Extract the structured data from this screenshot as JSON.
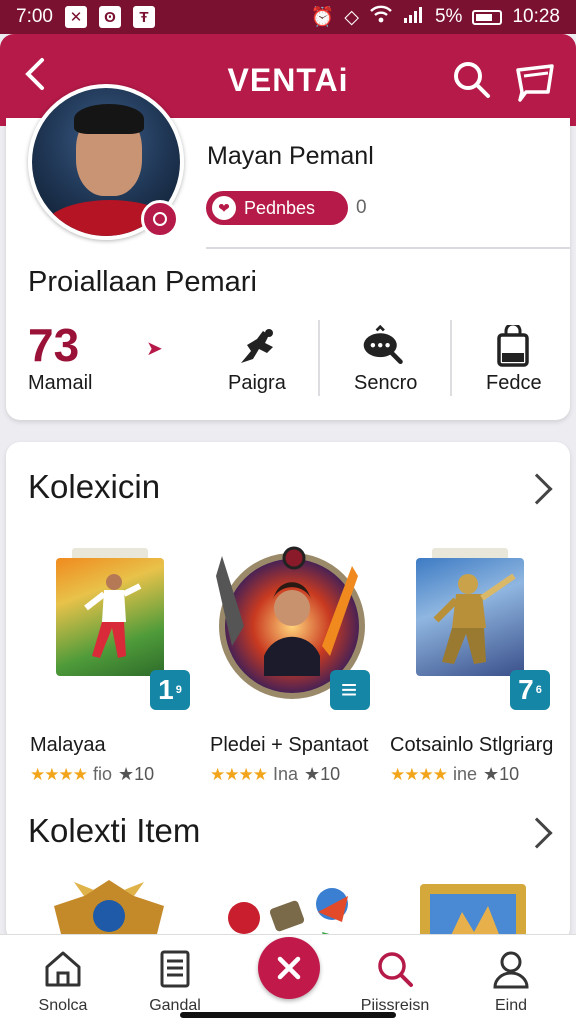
{
  "status_bar": {
    "time": "7:00",
    "battery": "5%",
    "clock": "10:28",
    "left_icons": [
      "x-icon",
      "o-icon",
      "t-icon"
    ]
  },
  "app_bar": {
    "title": "VENTAi"
  },
  "profile": {
    "name": "Mayan Pemanl",
    "tag_label": "Pednbes",
    "tag_count": "0",
    "section_title": "Proiallaan Pemari",
    "stats": [
      {
        "value": "73",
        "label": "Mamail"
      },
      {
        "label": "Paigra",
        "icon": "robot-icon"
      },
      {
        "label": "Sencro",
        "icon": "chat-search-icon"
      },
      {
        "label": "Fedce",
        "icon": "bag-icon"
      }
    ]
  },
  "collection": {
    "title": "Kolexicin",
    "items": [
      {
        "name": "Malayaa",
        "rating_text": "fio",
        "count": "★10",
        "badge": "1",
        "badge_small": "9"
      },
      {
        "name": "Pledei + Spantaot",
        "rating_text": "Ina",
        "count": "★10",
        "badge": "≡",
        "badge_small": ""
      },
      {
        "name": "Cotsainlo Stlgriarg",
        "rating_text": "ine",
        "count": "★10",
        "badge": "7",
        "badge_small": "6"
      }
    ]
  },
  "collection_items": {
    "title": "Kolexti Item"
  },
  "bottom_nav": {
    "items": [
      {
        "label": "Snolca",
        "icon": "home-icon"
      },
      {
        "label": "Gandal",
        "icon": "document-icon"
      },
      {
        "label": "Piissreisn",
        "icon": "search-icon"
      },
      {
        "label": "Eind",
        "icon": "user-icon"
      }
    ]
  },
  "colors": {
    "primary": "#b51a48",
    "status_bar": "#7a1130",
    "badge": "#1586a6",
    "star": "#f2a51a"
  }
}
